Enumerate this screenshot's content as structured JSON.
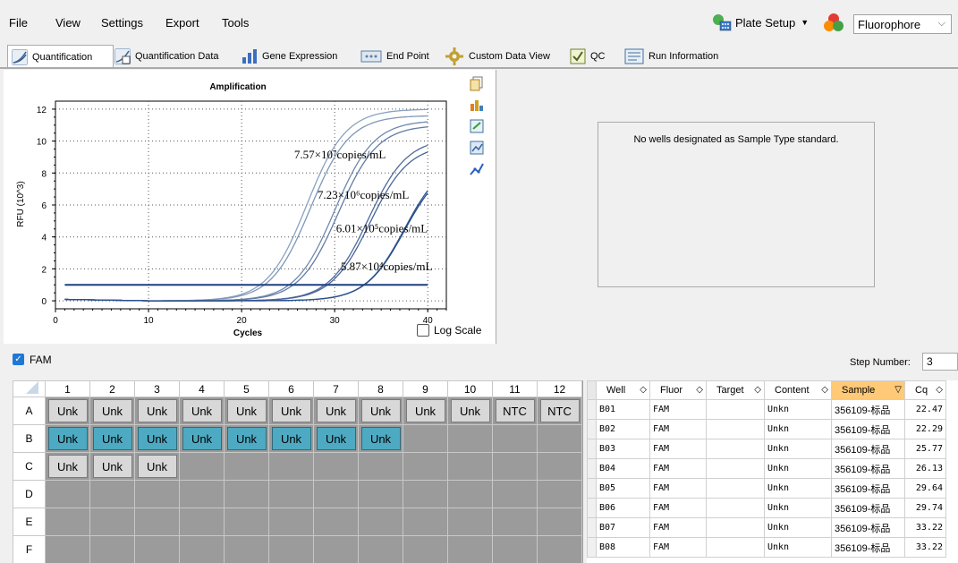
{
  "menubar": {
    "items": [
      "File",
      "View",
      "Settings",
      "Export",
      "Tools"
    ],
    "plate_setup": "Plate Setup",
    "fluorophore": "Fluorophore"
  },
  "tabs": [
    {
      "label": "Quantification",
      "icon": "quantification-icon",
      "color": "#5a7fa8"
    },
    {
      "label": "Quantification Data",
      "icon": "quantification-data-icon",
      "color": "#5a7fa8"
    },
    {
      "label": "Gene Expression",
      "icon": "gene-expression-icon",
      "color": "#3a6fc0"
    },
    {
      "label": "End Point",
      "icon": "end-point-icon",
      "color": "#5a7fa8"
    },
    {
      "label": "Custom Data View",
      "icon": "custom-data-view-icon",
      "color": "#c0a030"
    },
    {
      "label": "QC",
      "icon": "qc-icon",
      "color": "#708030"
    },
    {
      "label": "Run Information",
      "icon": "run-information-icon",
      "color": "#4070a0"
    }
  ],
  "chart_data": {
    "type": "line",
    "title": "Amplification",
    "xlabel": "Cycles",
    "ylabel": "RFU (10^3)",
    "xlim": [
      0,
      42
    ],
    "ylim": [
      -0.5,
      12.5
    ],
    "xticks": [
      0,
      10,
      20,
      30,
      40
    ],
    "yticks": [
      0,
      2,
      4,
      6,
      8,
      10,
      12
    ],
    "threshold": 1.0,
    "series": [
      {
        "values_midpoint": 27.0,
        "plateau": 12.0
      },
      {
        "values_midpoint": 27.4,
        "plateau": 11.6
      },
      {
        "values_midpoint": 30.0,
        "plateau": 11.3
      },
      {
        "values_midpoint": 30.4,
        "plateau": 11.0
      },
      {
        "values_midpoint": 33.6,
        "plateau": 10.2
      },
      {
        "values_midpoint": 33.8,
        "plateau": 9.8
      },
      {
        "values_midpoint": 37.5,
        "plateau": 9.0
      },
      {
        "values_midpoint": 37.5,
        "plateau": 8.8
      }
    ],
    "annotations": [
      {
        "text": "7.57×10⁷copies/mL",
        "x": 35.5,
        "y": 8.9
      },
      {
        "text": "7.23×10⁶copies/mL",
        "x": 38.0,
        "y": 6.4
      },
      {
        "text": "6.01×10⁵copies/mL",
        "x": 40.0,
        "y": 4.3
      },
      {
        "text": "5.87×10⁴copies/mL",
        "x": 40.5,
        "y": 1.9
      }
    ],
    "log_scale_label": "Log Scale"
  },
  "right_panel": {
    "message": "No wells designated as Sample Type standard."
  },
  "fam_bar": {
    "label": "FAM",
    "step_label": "Step Number:",
    "step_value": "3"
  },
  "plate": {
    "columns": [
      "1",
      "2",
      "3",
      "4",
      "5",
      "6",
      "7",
      "8",
      "9",
      "10",
      "11",
      "12"
    ],
    "rows": [
      {
        "label": "A",
        "wells": [
          "Unk",
          "Unk",
          "Unk",
          "Unk",
          "Unk",
          "Unk",
          "Unk",
          "Unk",
          "Unk",
          "Unk",
          "NTC",
          "NTC"
        ],
        "selected": []
      },
      {
        "label": "B",
        "wells": [
          "Unk",
          "Unk",
          "Unk",
          "Unk",
          "Unk",
          "Unk",
          "Unk",
          "Unk"
        ],
        "selected": [
          0,
          1,
          2,
          3,
          4,
          5,
          6,
          7
        ]
      },
      {
        "label": "C",
        "wells": [
          "Unk",
          "Unk",
          "Unk"
        ],
        "selected": []
      },
      {
        "label": "D",
        "wells": [],
        "selected": []
      },
      {
        "label": "E",
        "wells": [],
        "selected": []
      },
      {
        "label": "F",
        "wells": [],
        "selected": []
      }
    ]
  },
  "results": {
    "headers": [
      "Well",
      "Fluor",
      "Target",
      "Content",
      "Sample",
      "Cq"
    ],
    "rows": [
      [
        "B01",
        "FAM",
        "",
        "Unkn",
        "356109-标品",
        "22.47"
      ],
      [
        "B02",
        "FAM",
        "",
        "Unkn",
        "356109-标品",
        "22.29"
      ],
      [
        "B03",
        "FAM",
        "",
        "Unkn",
        "356109-标品",
        "25.77"
      ],
      [
        "B04",
        "FAM",
        "",
        "Unkn",
        "356109-标品",
        "26.13"
      ],
      [
        "B05",
        "FAM",
        "",
        "Unkn",
        "356109-标品",
        "29.64"
      ],
      [
        "B06",
        "FAM",
        "",
        "Unkn",
        "356109-标品",
        "29.74"
      ],
      [
        "B07",
        "FAM",
        "",
        "Unkn",
        "356109-标品",
        "33.22"
      ],
      [
        "B08",
        "FAM",
        "",
        "Unkn",
        "356109-标品",
        "33.22"
      ]
    ]
  }
}
